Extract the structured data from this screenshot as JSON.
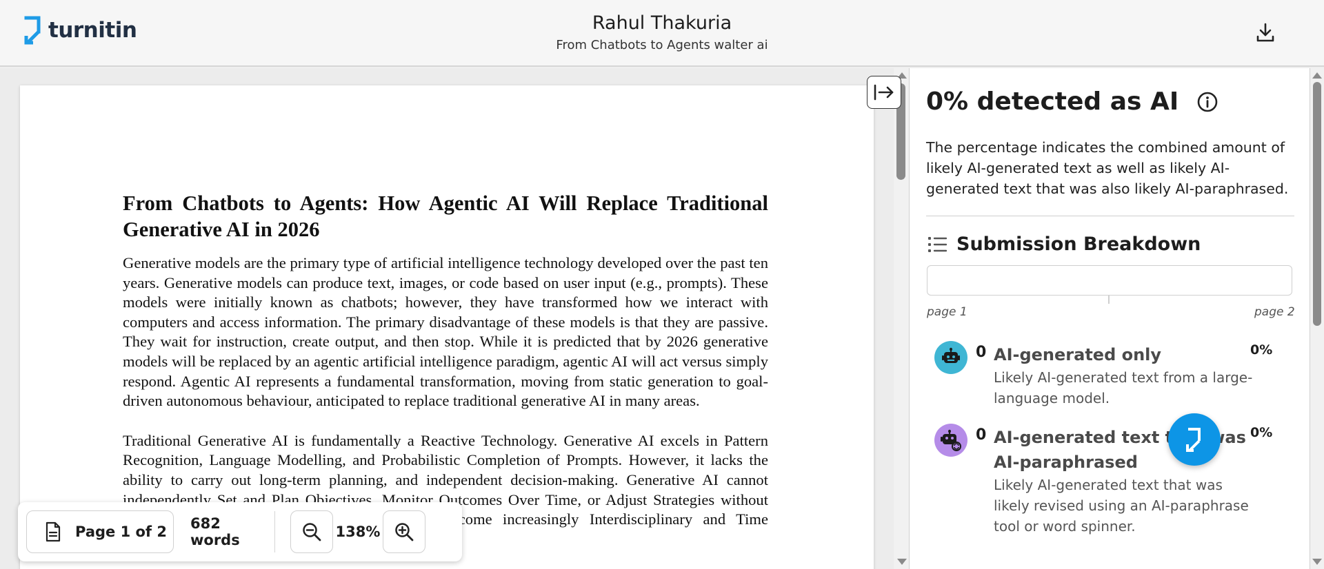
{
  "header": {
    "logo_text": "turnitin",
    "author": "Rahul Thakuria",
    "document_title": "From Chatbots to Agents walter ai",
    "download_icon": "download-icon"
  },
  "document": {
    "heading": "From Chatbots to Agents: How Agentic AI Will Replace Traditional Generative AI in 2026",
    "paragraphs": [
      "Generative models are the primary type of artificial intelligence technology developed over the past ten years. Generative models can produce text, images, or code based on user input (e.g., prompts). These models were initially known as chatbots; however, they have transformed how we interact with computers and access information. The primary disadvantage of these models is that they are passive. They wait for instruction, create output, and then stop. While it is predicted that by 2026 generative models will be replaced by an agentic artificial intelligence paradigm, agentic AI will act versus simply respond. Agentic AI represents a fundamental transformation, moving from static generation to goal-driven autonomous behaviour, anticipated to replace traditional generative AI in many areas.",
      "Traditional Generative AI is fundamentally a Reactive Technology. Generative AI excels in Pattern Recognition, Language Modelling, and Probabilistic Completion of Prompts. However, it lacks the ability to carry out long-term planning, and independent decision-making. Generative AI cannot independently Set and Plan Objectives, Monitor Outcomes Over Time, or Adjust Strategies without Human intervention. Therefore, as workloads become increasingly Interdisciplinary and Time Sensitive, these limitations are becoming increasingly"
    ]
  },
  "toolbar": {
    "page_label": "Page 1 of 2",
    "words_label": "682 words",
    "zoom_value": "138%"
  },
  "panel": {
    "detect_title": "0% detected as AI",
    "detect_description": "The percentage indicates the combined amount of likely AI-generated text as well as likely AI-generated text that was also likely AI-paraphrased.",
    "breakdown_title": "Submission Breakdown",
    "page_start": "page 1",
    "page_end": "page 2",
    "items": [
      {
        "count": "0",
        "title": "AI-generated only",
        "percent": "0%",
        "description": "Likely AI-generated text from a large-language model.",
        "icon": "robot-icon",
        "color": "#3fb6d4"
      },
      {
        "count": "0",
        "title": "AI-generated text that was AI-paraphrased",
        "percent": "0%",
        "description": "Likely AI-generated text that was likely revised using an AI-paraphrase tool or word spinner.",
        "icon": "robot-paraphrase-icon",
        "color": "#b58ce8"
      }
    ]
  },
  "colors": {
    "brand_blue": "#0d95e6",
    "logo_text": "#223044"
  }
}
